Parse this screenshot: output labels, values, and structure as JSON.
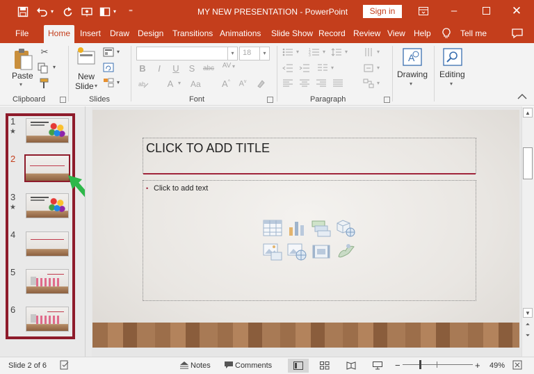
{
  "window": {
    "title": "MY NEW PRESENTATION  -  PowerPoint",
    "sign_in": "Sign in"
  },
  "tabs": [
    "File",
    "Home",
    "Insert",
    "Draw",
    "Design",
    "Transitions",
    "Animations",
    "Slide Show",
    "Record",
    "Review",
    "View",
    "Help",
    "Tell me"
  ],
  "active_tab": "Home",
  "ribbon": {
    "clipboard": {
      "paste": "Paste",
      "label": "Clipboard"
    },
    "slides": {
      "new_slide_line1": "New",
      "new_slide_line2": "Slide",
      "label": "Slides"
    },
    "font": {
      "font_size": "18",
      "label": "Font"
    },
    "paragraph": {
      "label": "Paragraph"
    },
    "drawing": {
      "label": "Drawing"
    },
    "editing": {
      "label": "Editing"
    }
  },
  "thumbnails": [
    {
      "number": "1",
      "starred": true,
      "selected": false
    },
    {
      "number": "2",
      "starred": false,
      "selected": true
    },
    {
      "number": "3",
      "starred": true,
      "selected": false
    },
    {
      "number": "4",
      "starred": false,
      "selected": false
    },
    {
      "number": "5",
      "starred": false,
      "selected": false
    },
    {
      "number": "6",
      "starred": false,
      "selected": false
    }
  ],
  "slide": {
    "title_placeholder": "CLICK TO ADD TITLE",
    "body_placeholder": "Click to add text"
  },
  "status": {
    "slide_indicator": "Slide 2 of 6",
    "notes": "Notes",
    "comments": "Comments",
    "zoom_minus": "−",
    "zoom_plus": "+",
    "zoom_level": "49%"
  },
  "colors": {
    "accent": "#c43e1c",
    "selection_border": "#8e1b2b",
    "pointer_arrow": "#2db84a"
  }
}
